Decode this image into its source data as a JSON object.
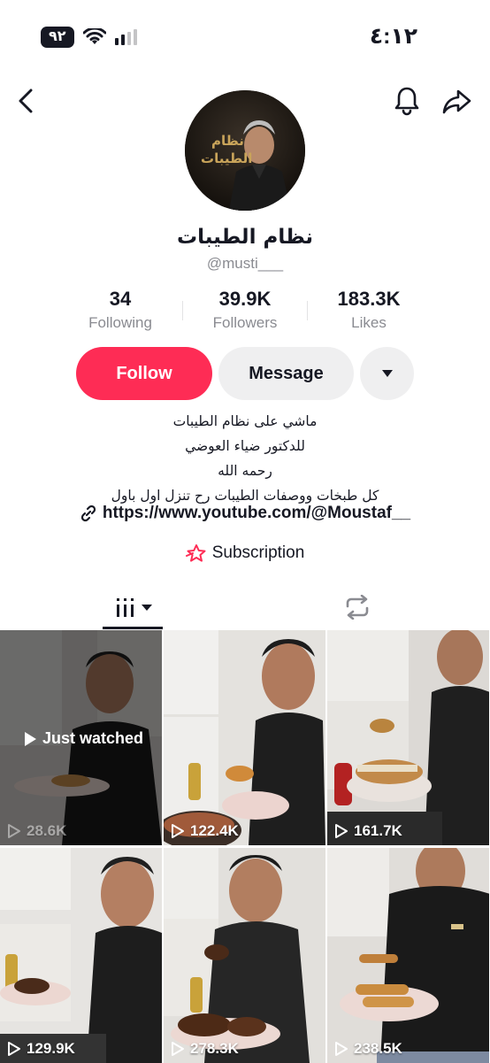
{
  "status_bar": {
    "time": "٤:١٢",
    "battery": "٩٢"
  },
  "profile": {
    "display_name": "نظام الطيبات",
    "username": "@musti___",
    "avatar_text_line1": "نظام",
    "avatar_text_line2": "الطيبات"
  },
  "stats": [
    {
      "value": "34",
      "label": "Following"
    },
    {
      "value": "39.9K",
      "label": "Followers"
    },
    {
      "value": "183.3K",
      "label": "Likes"
    }
  ],
  "actions": {
    "follow": "Follow",
    "message": "Message"
  },
  "bio": {
    "lines": [
      "ماشي على نظام الطيبات",
      "للدكتور ضياء العوضي",
      "رحمه الله",
      "كل طبخات ووصفات الطيبات رح تنزل اول باول"
    ],
    "link": "https://www.youtube.com/@Moustaf__",
    "subscription": "Subscription"
  },
  "colors": {
    "accent": "#fe2c55",
    "text": "#161823",
    "muted": "#8a8b91"
  },
  "videos": [
    {
      "views": "28.6K",
      "badge": "Just watched"
    },
    {
      "views": "122.4K"
    },
    {
      "views": "161.7K"
    },
    {
      "views": "129.9K"
    },
    {
      "views": "278.3K"
    },
    {
      "views": "238.5K"
    }
  ]
}
